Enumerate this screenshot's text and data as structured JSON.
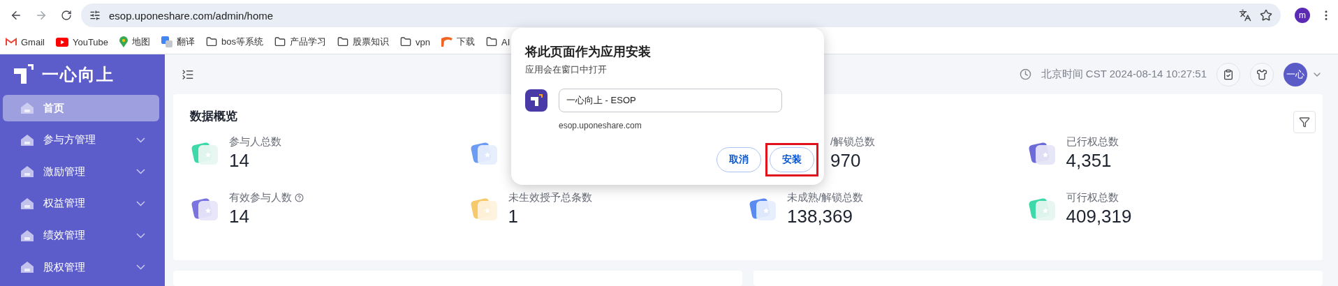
{
  "browser": {
    "url": "esop.uponeshare.com/admin/home",
    "profile": "m",
    "bookmarks": [
      {
        "label": "Gmail",
        "kind": "mail"
      },
      {
        "label": "YouTube",
        "kind": "video"
      },
      {
        "label": "地图",
        "kind": "map"
      },
      {
        "label": "翻译",
        "kind": "translate"
      },
      {
        "label": "bos等系统",
        "kind": "folder"
      },
      {
        "label": "产品学习",
        "kind": "folder"
      },
      {
        "label": "股票知识",
        "kind": "folder"
      },
      {
        "label": "vpn",
        "kind": "folder"
      },
      {
        "label": "下载",
        "kind": "download"
      },
      {
        "label": "AI",
        "kind": "folder"
      }
    ]
  },
  "sidebar": {
    "logo": "一心向上",
    "items": [
      {
        "label": "首页",
        "selected": true,
        "expandable": false
      },
      {
        "label": "参与方管理",
        "selected": false,
        "expandable": true
      },
      {
        "label": "激励管理",
        "selected": false,
        "expandable": true
      },
      {
        "label": "权益管理",
        "selected": false,
        "expandable": true
      },
      {
        "label": "绩效管理",
        "selected": false,
        "expandable": true
      },
      {
        "label": "股权管理",
        "selected": false,
        "expandable": true
      }
    ]
  },
  "header": {
    "time": "北京时间 CST 2024-08-14 10:27:51",
    "avatar": "一心"
  },
  "overview": {
    "title": "数据概览",
    "stats": [
      {
        "kind": "full",
        "label": "参与人总数",
        "value": "14",
        "help": false
      },
      {
        "kind": "covered"
      },
      {
        "kind": "clipped",
        "label": "/解锁总数",
        "value": "970"
      },
      {
        "kind": "full",
        "label": "已行权总数",
        "value": "4,351",
        "help": false
      },
      {
        "kind": "full",
        "label": "有效参与人数",
        "value": "14",
        "help": true
      },
      {
        "kind": "full",
        "label": "未生效授予总条数",
        "value": "1",
        "help": false
      },
      {
        "kind": "full",
        "label": "未成熟/解锁总数",
        "value": "138,369",
        "help": false
      },
      {
        "kind": "full",
        "label": "可行权总数",
        "value": "409,319",
        "help": false
      }
    ]
  },
  "install_dialog": {
    "title": "将此页面作为应用安装",
    "subtitle": "应用会在窗口中打开",
    "name_value": "一心向上 - ESOP",
    "domain": "esop.uponeshare.com",
    "buttons": [
      {
        "label": "取消",
        "highlighted": false
      },
      {
        "label": "安装",
        "highlighted": true
      }
    ]
  }
}
